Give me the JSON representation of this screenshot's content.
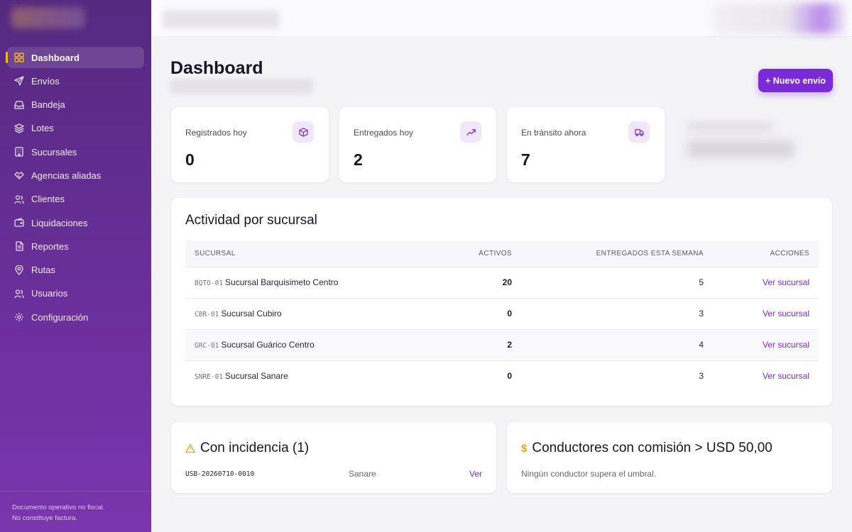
{
  "sidebar": {
    "items": [
      {
        "label": "Dashboard",
        "icon": "grid-icon",
        "active": true
      },
      {
        "label": "Envíos",
        "icon": "send-icon"
      },
      {
        "label": "Bandeja",
        "icon": "inbox-icon"
      },
      {
        "label": "Lotes",
        "icon": "layers-icon"
      },
      {
        "label": "Sucursales",
        "icon": "building-icon"
      },
      {
        "label": "Agencias aliadas",
        "icon": "handshake-icon"
      },
      {
        "label": "Clientes",
        "icon": "users-icon"
      },
      {
        "label": "Liquidaciones",
        "icon": "wallet-icon"
      },
      {
        "label": "Reportes",
        "icon": "file-icon"
      },
      {
        "label": "Rutas",
        "icon": "map-pin-icon"
      },
      {
        "label": "Usuarios",
        "icon": "user-group-icon"
      },
      {
        "label": "Configuración",
        "icon": "gear-icon"
      }
    ],
    "footer_line1": "Documento operativo no fiscal.",
    "footer_line2": "No constituye factura."
  },
  "page": {
    "title": "Dashboard",
    "new_button": "+ Nuevo envío"
  },
  "stats": [
    {
      "label": "Registrados hoy",
      "value": "0",
      "icon": "box-icon"
    },
    {
      "label": "Entregados hoy",
      "value": "2",
      "icon": "trend-up-icon"
    },
    {
      "label": "En tránsito ahora",
      "value": "7",
      "icon": "truck-icon"
    }
  ],
  "activity": {
    "title": "Actividad por sucursal",
    "columns": {
      "branch": "Sucursal",
      "active": "Activos",
      "delivered": "Entregados esta semana",
      "actions": "Acciones"
    },
    "rows": [
      {
        "code": "BQTO-01",
        "name": "Sucursal Barquisimeto Centro",
        "active": "20",
        "delivered": "5",
        "action": "Ver sucursal"
      },
      {
        "code": "CBR-01",
        "name": "Sucursal Cubiro",
        "active": "0",
        "delivered": "3",
        "action": "Ver sucursal"
      },
      {
        "code": "GRC-01",
        "name": "Sucursal Guárico Centro",
        "active": "2",
        "delivered": "4",
        "action": "Ver sucursal"
      },
      {
        "code": "SNRE-01",
        "name": "Sucursal Sanare",
        "active": "0",
        "delivered": "3",
        "action": "Ver sucursal"
      }
    ]
  },
  "incidents": {
    "title": "Con incidencia (1)",
    "icon": "warning-icon",
    "item": {
      "code": "USB-20260710-0010",
      "place": "Sanare",
      "action": "Ver"
    }
  },
  "drivers": {
    "title": "Conductores con comisión > USD 50,00",
    "icon": "dollar-icon",
    "empty": "Ningún conductor supera el umbral."
  },
  "colors": {
    "accent": "#7b2bd6",
    "sidebar": "#6a2f9a",
    "warning": "#f0a31a",
    "active_marker": "#f5b421"
  }
}
